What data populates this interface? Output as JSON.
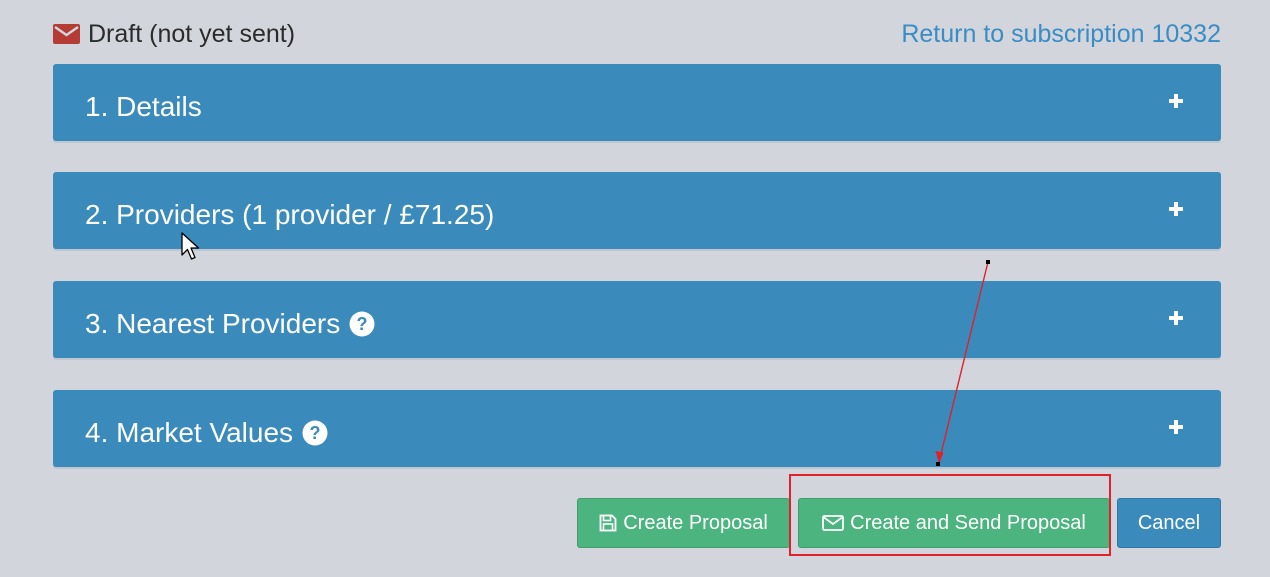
{
  "status": {
    "icon": "envelope-icon",
    "label": "Draft (not yet sent)",
    "icon_color": "#b43c34"
  },
  "return_link": {
    "label": "Return to subscription 10332"
  },
  "panels": [
    {
      "label": "1. Details",
      "has_help": false
    },
    {
      "label": "2. Providers (1 provider / £71.25)",
      "has_help": false
    },
    {
      "label": "3. Nearest Providers",
      "has_help": true
    },
    {
      "label": "4. Market Values",
      "has_help": true
    }
  ],
  "buttons": {
    "create_proposal": "Create Proposal",
    "create_and_send": "Create and Send Proposal",
    "cancel": "Cancel"
  },
  "colors": {
    "background": "#d2d6dc",
    "panel": "#3a8bbc",
    "link": "#3a8cc4",
    "success": "#4cb47f",
    "annotation": "#e0202a"
  }
}
